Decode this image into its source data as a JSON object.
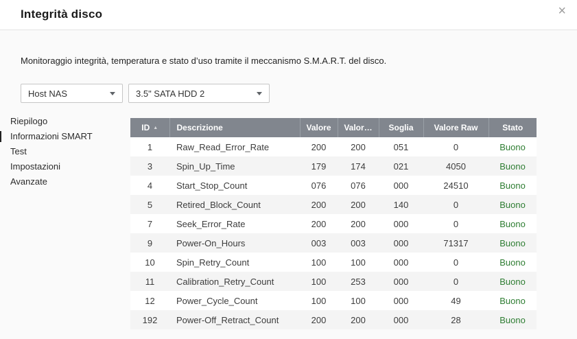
{
  "dialog": {
    "title": "Integrità disco",
    "close_icon": "×",
    "description": "Monitoraggio integrità, temperatura e stato d’uso tramite il meccanismo S.M.A.R.T. del disco."
  },
  "selectors": {
    "host": {
      "value": "Host NAS"
    },
    "disk": {
      "value": "3.5\" SATA HDD 2"
    }
  },
  "sidebar": {
    "items": [
      {
        "label": "Riepilogo",
        "active": false
      },
      {
        "label": "Informazioni SMART",
        "active": true
      },
      {
        "label": "Test",
        "active": false
      },
      {
        "label": "Impostazioni",
        "active": false
      },
      {
        "label": "Avanzate",
        "active": false
      }
    ]
  },
  "table": {
    "header_bg": "#81868e",
    "status_color": "#2e7d32",
    "columns": [
      {
        "label": "ID",
        "sort": "asc",
        "sort_icon": "▲"
      },
      {
        "label": "Descrizione"
      },
      {
        "label": "Valore"
      },
      {
        "label": "Valor…"
      },
      {
        "label": "Soglia"
      },
      {
        "label": "Valore Raw"
      },
      {
        "label": "Stato"
      }
    ],
    "rows": [
      [
        "1",
        "Raw_Read_Error_Rate",
        "200",
        "200",
        "051",
        "0",
        "Buono"
      ],
      [
        "3",
        "Spin_Up_Time",
        "179",
        "174",
        "021",
        "4050",
        "Buono"
      ],
      [
        "4",
        "Start_Stop_Count",
        "076",
        "076",
        "000",
        "24510",
        "Buono"
      ],
      [
        "5",
        "Retired_Block_Count",
        "200",
        "200",
        "140",
        "0",
        "Buono"
      ],
      [
        "7",
        "Seek_Error_Rate",
        "200",
        "200",
        "000",
        "0",
        "Buono"
      ],
      [
        "9",
        "Power-On_Hours",
        "003",
        "003",
        "000",
        "71317",
        "Buono"
      ],
      [
        "10",
        "Spin_Retry_Count",
        "100",
        "100",
        "000",
        "0",
        "Buono"
      ],
      [
        "11",
        "Calibration_Retry_Count",
        "100",
        "253",
        "000",
        "0",
        "Buono"
      ],
      [
        "12",
        "Power_Cycle_Count",
        "100",
        "100",
        "000",
        "49",
        "Buono"
      ],
      [
        "192",
        "Power-Off_Retract_Count",
        "200",
        "200",
        "000",
        "28",
        "Buono"
      ]
    ]
  }
}
